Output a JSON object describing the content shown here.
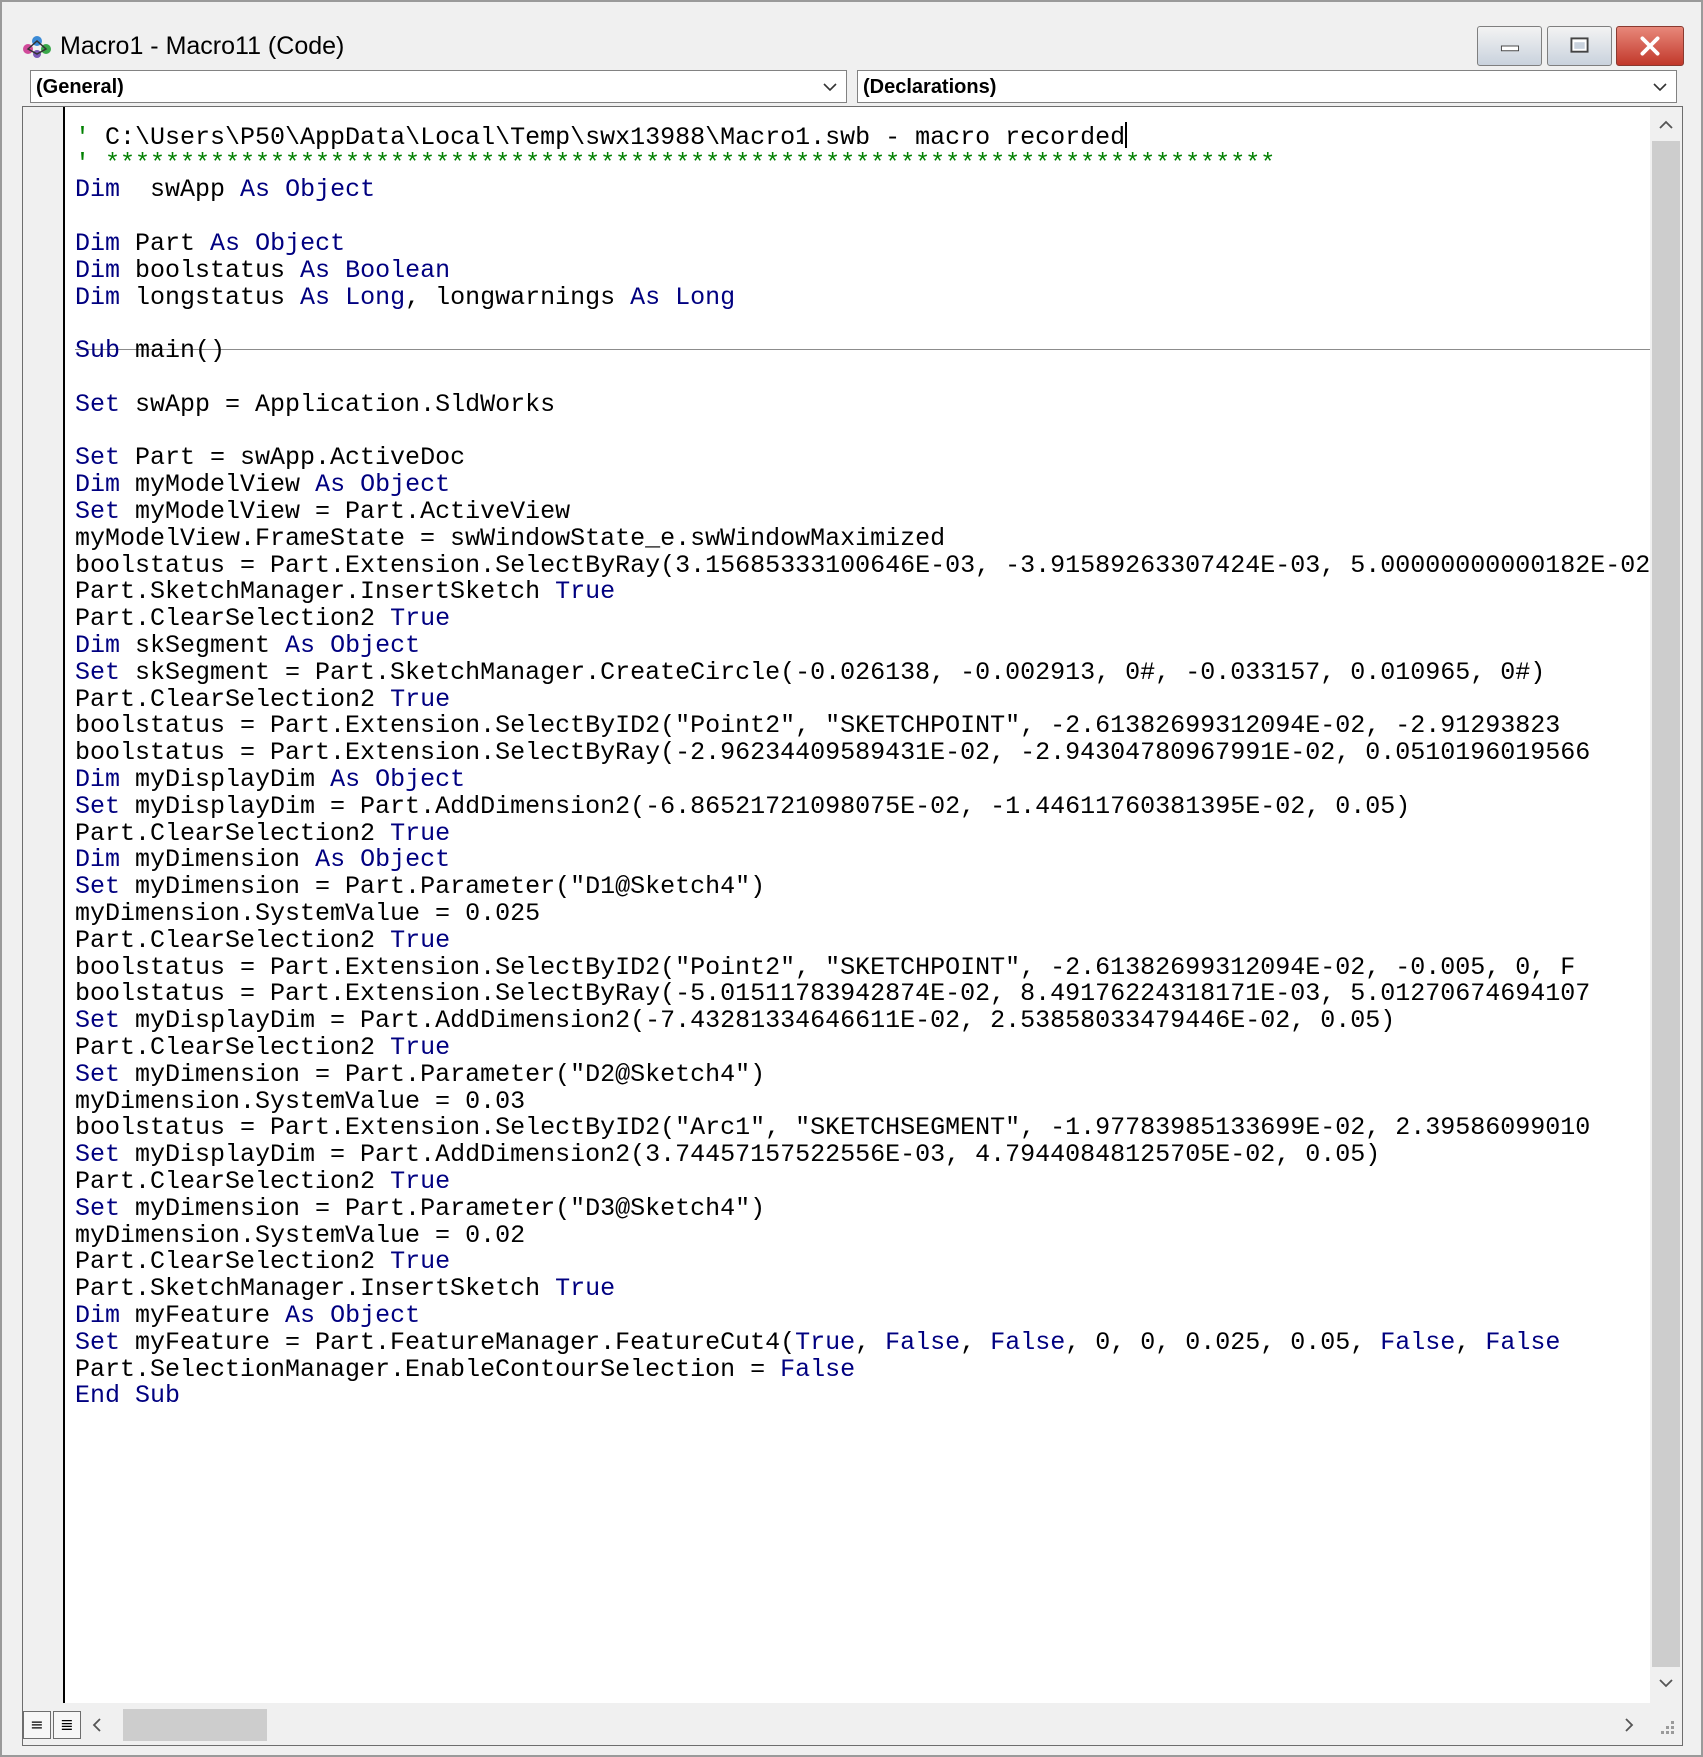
{
  "window": {
    "title": "Macro1 - Macro11 (Code)",
    "controls": {
      "minimize": "minimize",
      "maximize": "maximize",
      "close": "close"
    }
  },
  "dropdowns": {
    "object": {
      "selected": "(General)"
    },
    "procedure": {
      "selected": "(Declarations)"
    }
  },
  "icons": {
    "app": "vba-project-icon",
    "dropdown_arrow": "chevron-down-icon",
    "scroll_up": "chevron-up-icon",
    "scroll_down": "chevron-down-icon",
    "scroll_left": "chevron-left-icon",
    "scroll_right": "chevron-right-icon",
    "procedure_view": "procedure-view-icon",
    "full_module_view": "full-module-view-icon"
  },
  "colors": {
    "keyword": "#000080",
    "comment": "#008000",
    "text": "#000000",
    "close_button": "#c2382b"
  },
  "code": {
    "lines": [
      {
        "y": 0,
        "tokens": [
          [
            "cm",
            "' ******************************************************************************"
          ]
        ]
      },
      {
        "y": 1,
        "tokens": [
          [
            "cm",
            "' C:\\Users\\P50\\AppData\\Local\\Temp\\swx13988\\Macro1.swb - macro recorded"
          ]
        ],
        "caret": true,
        "noColorComment": true
      },
      {
        "y": 2,
        "tokens": [
          [
            "cm",
            "' ******************************************************************************"
          ]
        ]
      },
      {
        "y": 3,
        "tokens": [
          [
            "kw",
            "Dim"
          ],
          [
            "",
            "  swApp "
          ],
          [
            "kw",
            "As"
          ],
          [
            "",
            " "
          ],
          [
            "kw",
            "Object"
          ]
        ]
      },
      {
        "y": 5,
        "tokens": [
          [
            "kw",
            "Dim"
          ],
          [
            "",
            " Part "
          ],
          [
            "kw",
            "As"
          ],
          [
            "",
            " "
          ],
          [
            "kw",
            "Object"
          ]
        ]
      },
      {
        "y": 6,
        "tokens": [
          [
            "kw",
            "Dim"
          ],
          [
            "",
            " boolstatus "
          ],
          [
            "kw",
            "As"
          ],
          [
            "",
            " "
          ],
          [
            "kw",
            "Boolean"
          ]
        ]
      },
      {
        "y": 7,
        "tokens": [
          [
            "kw",
            "Dim"
          ],
          [
            "",
            " longstatus "
          ],
          [
            "kw",
            "As"
          ],
          [
            "",
            " "
          ],
          [
            "kw",
            "Long"
          ],
          [
            "",
            ", longwarnings "
          ],
          [
            "kw",
            "As"
          ],
          [
            "",
            " "
          ],
          [
            "kw",
            "Long"
          ]
        ]
      },
      {
        "y": 9,
        "tokens": [
          [
            "kw",
            "Sub"
          ],
          [
            "",
            " main()"
          ]
        ]
      },
      {
        "y": 11,
        "tokens": [
          [
            "kw",
            "Set"
          ],
          [
            "",
            " swApp = Application.SldWorks"
          ]
        ]
      },
      {
        "y": 13,
        "tokens": [
          [
            "kw",
            "Set"
          ],
          [
            "",
            " Part = swApp.ActiveDoc"
          ]
        ]
      },
      {
        "y": 14,
        "tokens": [
          [
            "kw",
            "Dim"
          ],
          [
            "",
            " myModelView "
          ],
          [
            "kw",
            "As"
          ],
          [
            "",
            " "
          ],
          [
            "kw",
            "Object"
          ]
        ]
      },
      {
        "y": 15,
        "tokens": [
          [
            "kw",
            "Set"
          ],
          [
            "",
            " myModelView = Part.ActiveView"
          ]
        ]
      },
      {
        "y": 16,
        "tokens": [
          [
            "",
            "myModelView.FrameState = swWindowState_e.swWindowMaximized"
          ]
        ]
      },
      {
        "y": 17,
        "tokens": [
          [
            "",
            "boolstatus = Part.Extension.SelectByRay(3.15685333100646E-03, -3.91589263307424E-03, 5.00000000000182E-02"
          ]
        ]
      },
      {
        "y": 18,
        "tokens": [
          [
            "",
            "Part.SketchManager.InsertSketch "
          ],
          [
            "kw",
            "True"
          ]
        ]
      },
      {
        "y": 19,
        "tokens": [
          [
            "",
            "Part.ClearSelection2 "
          ],
          [
            "kw",
            "True"
          ]
        ]
      },
      {
        "y": 20,
        "tokens": [
          [
            "kw",
            "Dim"
          ],
          [
            "",
            " skSegment "
          ],
          [
            "kw",
            "As"
          ],
          [
            "",
            " "
          ],
          [
            "kw",
            "Object"
          ]
        ]
      },
      {
        "y": 21,
        "tokens": [
          [
            "kw",
            "Set"
          ],
          [
            "",
            " skSegment = Part.SketchManager.CreateCircle(-0.026138, -0.002913, 0#, -0.033157, 0.010965, 0#)"
          ]
        ]
      },
      {
        "y": 22,
        "tokens": [
          [
            "",
            "Part.ClearSelection2 "
          ],
          [
            "kw",
            "True"
          ]
        ]
      },
      {
        "y": 23,
        "tokens": [
          [
            "",
            "boolstatus = Part.Extension.SelectByID2(\"Point2\", \"SKETCHPOINT\", -2.61382699312094E-02, -2.91293823"
          ]
        ]
      },
      {
        "y": 24,
        "tokens": [
          [
            "",
            "boolstatus = Part.Extension.SelectByRay(-2.96234409589431E-02, -2.94304780967991E-02, 0.0510196019566"
          ]
        ]
      },
      {
        "y": 25,
        "tokens": [
          [
            "kw",
            "Dim"
          ],
          [
            "",
            " myDisplayDim "
          ],
          [
            "kw",
            "As"
          ],
          [
            "",
            " "
          ],
          [
            "kw",
            "Object"
          ]
        ]
      },
      {
        "y": 26,
        "tokens": [
          [
            "kw",
            "Set"
          ],
          [
            "",
            " myDisplayDim = Part.AddDimension2(-6.86521721098075E-02, -1.44611760381395E-02, 0.05)"
          ]
        ]
      },
      {
        "y": 27,
        "tokens": [
          [
            "",
            "Part.ClearSelection2 "
          ],
          [
            "kw",
            "True"
          ]
        ]
      },
      {
        "y": 28,
        "tokens": [
          [
            "kw",
            "Dim"
          ],
          [
            "",
            " myDimension "
          ],
          [
            "kw",
            "As"
          ],
          [
            "",
            " "
          ],
          [
            "kw",
            "Object"
          ]
        ]
      },
      {
        "y": 29,
        "tokens": [
          [
            "kw",
            "Set"
          ],
          [
            "",
            " myDimension = Part.Parameter(\"D1@Sketch4\")"
          ]
        ]
      },
      {
        "y": 30,
        "tokens": [
          [
            "",
            "myDimension.SystemValue = 0.025"
          ]
        ]
      },
      {
        "y": 31,
        "tokens": [
          [
            "",
            "Part.ClearSelection2 "
          ],
          [
            "kw",
            "True"
          ]
        ]
      },
      {
        "y": 32,
        "tokens": [
          [
            "",
            "boolstatus = Part.Extension.SelectByID2(\"Point2\", \"SKETCHPOINT\", -2.61382699312094E-02, -0.005, 0, F"
          ]
        ]
      },
      {
        "y": 33,
        "tokens": [
          [
            "",
            "boolstatus = Part.Extension.SelectByRay(-5.01511783942874E-02, 8.49176224318171E-03, 5.01270674694107"
          ]
        ]
      },
      {
        "y": 34,
        "tokens": [
          [
            "kw",
            "Set"
          ],
          [
            "",
            " myDisplayDim = Part.AddDimension2(-7.43281334646611E-02, 2.53858033479446E-02, 0.05)"
          ]
        ]
      },
      {
        "y": 35,
        "tokens": [
          [
            "",
            "Part.ClearSelection2 "
          ],
          [
            "kw",
            "True"
          ]
        ]
      },
      {
        "y": 36,
        "tokens": [
          [
            "kw",
            "Set"
          ],
          [
            "",
            " myDimension = Part.Parameter(\"D2@Sketch4\")"
          ]
        ]
      },
      {
        "y": 37,
        "tokens": [
          [
            "",
            "myDimension.SystemValue = 0.03"
          ]
        ]
      },
      {
        "y": 38,
        "tokens": [
          [
            "",
            "boolstatus = Part.Extension.SelectByID2(\"Arc1\", \"SKETCHSEGMENT\", -1.97783985133699E-02, 2.39586099010"
          ]
        ]
      },
      {
        "y": 39,
        "tokens": [
          [
            "kw",
            "Set"
          ],
          [
            "",
            " myDisplayDim = Part.AddDimension2(3.74457157522556E-03, 4.79440848125705E-02, 0.05)"
          ]
        ]
      },
      {
        "y": 40,
        "tokens": [
          [
            "",
            "Part.ClearSelection2 "
          ],
          [
            "kw",
            "True"
          ]
        ]
      },
      {
        "y": 41,
        "tokens": [
          [
            "kw",
            "Set"
          ],
          [
            "",
            " myDimension = Part.Parameter(\"D3@Sketch4\")"
          ]
        ]
      },
      {
        "y": 42,
        "tokens": [
          [
            "",
            "myDimension.SystemValue = 0.02"
          ]
        ]
      },
      {
        "y": 43,
        "tokens": [
          [
            "",
            "Part.ClearSelection2 "
          ],
          [
            "kw",
            "True"
          ]
        ]
      },
      {
        "y": 44,
        "tokens": [
          [
            "",
            "Part.SketchManager.InsertSketch "
          ],
          [
            "kw",
            "True"
          ]
        ]
      },
      {
        "y": 45,
        "tokens": [
          [
            "kw",
            "Dim"
          ],
          [
            "",
            " myFeature "
          ],
          [
            "kw",
            "As"
          ],
          [
            "",
            " "
          ],
          [
            "kw",
            "Object"
          ]
        ]
      },
      {
        "y": 46,
        "tokens": [
          [
            "kw",
            "Set"
          ],
          [
            "",
            " myFeature = Part.FeatureManager.FeatureCut4("
          ],
          [
            "kw",
            "True"
          ],
          [
            "",
            ", "
          ],
          [
            "kw",
            "False"
          ],
          [
            "",
            ", "
          ],
          [
            "kw",
            "False"
          ],
          [
            "",
            ", 0, 0, 0.025, 0.05, "
          ],
          [
            "kw",
            "False"
          ],
          [
            "",
            ", "
          ],
          [
            "kw",
            "False"
          ]
        ]
      },
      {
        "y": 47,
        "tokens": [
          [
            "",
            "Part.SelectionManager.EnableContourSelection = "
          ],
          [
            "kw",
            "False"
          ]
        ]
      },
      {
        "y": 48,
        "tokens": [
          [
            "kw",
            "End"
          ],
          [
            "",
            " "
          ],
          [
            "kw",
            "Sub"
          ]
        ]
      }
    ]
  }
}
